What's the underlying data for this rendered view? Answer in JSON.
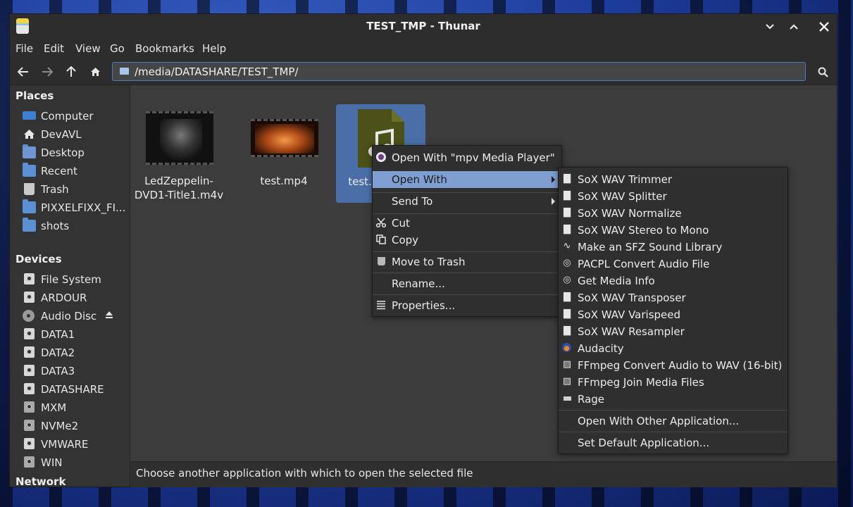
{
  "window": {
    "title": "TEST_TMP - Thunar"
  },
  "menubar": [
    "File",
    "Edit",
    "Go",
    "Bookmarks",
    "Help"
  ],
  "location": {
    "path": "/media/DATASHARE/TEST_TMP/"
  },
  "sidebar": {
    "places_heading": "Places",
    "places": [
      {
        "label": "Computer",
        "icon": "computer-icon"
      },
      {
        "label": "DevAVL",
        "icon": "home-icon"
      },
      {
        "label": "Desktop",
        "icon": "folder-icon"
      },
      {
        "label": "Recent",
        "icon": "recent-icon"
      },
      {
        "label": "Trash",
        "icon": "trash-icon"
      },
      {
        "label": "PIXXELFIXX_FI...",
        "icon": "folder-icon"
      },
      {
        "label": "shots",
        "icon": "folder-icon"
      }
    ],
    "devices_heading": "Devices",
    "devices": [
      {
        "label": "File System",
        "icon": "drive-icon"
      },
      {
        "label": "ARDOUR",
        "icon": "drive-icon"
      },
      {
        "label": "Audio Disc",
        "icon": "disc-icon"
      },
      {
        "label": "DATA1",
        "icon": "drive-icon"
      },
      {
        "label": "DATA2",
        "icon": "drive-icon"
      },
      {
        "label": "DATA3",
        "icon": "drive-icon"
      },
      {
        "label": "DATASHARE",
        "icon": "drive-icon"
      },
      {
        "label": "MXM",
        "icon": "drive-icon"
      },
      {
        "label": "NVMe2",
        "icon": "drive-icon"
      },
      {
        "label": "VMWARE",
        "icon": "drive-icon"
      },
      {
        "label": "WIN",
        "icon": "drive-icon"
      }
    ],
    "network_heading": "Network"
  },
  "files": [
    {
      "name_line1": "LedZeppelin-",
      "name_line2": "DVD1-Title1.m4v"
    },
    {
      "name_line1": "test.mp4",
      "name_line2": ""
    },
    {
      "name_line1": "test.",
      "name_line2": ""
    }
  ],
  "context_menu": {
    "open_with_default": "Open With \"mpv Media Player\"",
    "open_with": "Open With",
    "send_to": "Send To",
    "cut": "Cut",
    "copy": "Copy",
    "move_to_trash": "Move to Trash",
    "rename": "Rename...",
    "properties": "Properties..."
  },
  "submenu": {
    "apps": [
      {
        "label": "SoX WAV Trimmer",
        "icon": "sox-icon"
      },
      {
        "label": "SoX WAV Splitter",
        "icon": "sox-icon"
      },
      {
        "label": "SoX WAV Normalize",
        "icon": "sox-icon"
      },
      {
        "label": "SoX WAV Stereo to Mono",
        "icon": "sox-icon"
      },
      {
        "label": "Make an SFZ Sound Library",
        "icon": "waveform-icon"
      },
      {
        "label": "PACPL Convert Audio File",
        "icon": "pacpl-icon"
      },
      {
        "label": "Get Media Info",
        "icon": "mediainfo-icon"
      },
      {
        "label": "SoX WAV Transposer",
        "icon": "sox-icon"
      },
      {
        "label": "SoX WAV Varispeed",
        "icon": "sox-icon"
      },
      {
        "label": "SoX WAV Resampler",
        "icon": "sox-icon"
      },
      {
        "label": "Audacity",
        "icon": "audacity-icon"
      },
      {
        "label": "FFmpeg Convert Audio to WAV (16-bit)",
        "icon": "ffmpeg-icon"
      },
      {
        "label": "FFmpeg Join Media Files",
        "icon": "ffmpeg-icon"
      },
      {
        "label": "Rage",
        "icon": "rage-icon"
      }
    ],
    "open_with_other": "Open With Other Application...",
    "set_default": "Set Default Application..."
  },
  "statusbar": {
    "text": "Choose another application with which to open the selected file"
  }
}
